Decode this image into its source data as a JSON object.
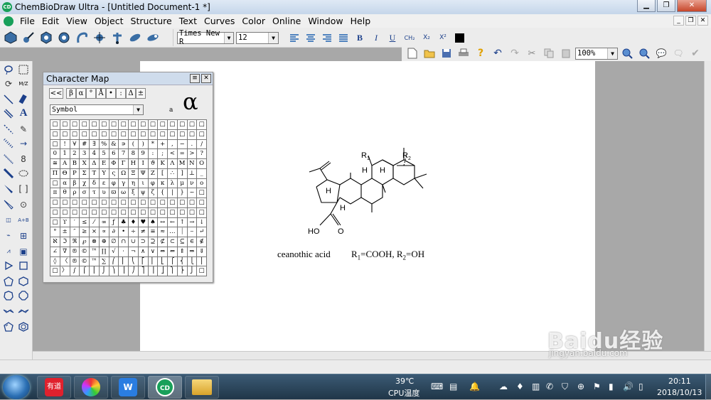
{
  "window": {
    "title": "ChemBioDraw Ultra - [Untitled Document-1 *]",
    "app_icon_text": "CD",
    "controls": [
      "minimize-icon",
      "restore-icon",
      "close-icon"
    ]
  },
  "menubar": {
    "items": [
      "File",
      "Edit",
      "View",
      "Object",
      "Structure",
      "Text",
      "Curves",
      "Color",
      "Online",
      "Window",
      "Help"
    ]
  },
  "text_toolbar": {
    "font_family_value": "Times New R",
    "font_size_value": "12",
    "bold": "B",
    "italic": "I",
    "underline": "U",
    "chem": "CH₂",
    "subscript": "X₂",
    "superscript": "X²"
  },
  "main_toolbar": {
    "zoom_value": "100%"
  },
  "character_map": {
    "title": "Character Map",
    "back_label": "<<",
    "recent": [
      "β",
      "α",
      "°",
      "Å",
      "•",
      ":",
      "Δ",
      "±"
    ],
    "font_value": "Symbol",
    "preview_small": "a",
    "preview_big": "α",
    "rows": [
      [
        "",
        "",
        "",
        "",
        "",
        "",
        "",
        "",
        "",
        "",
        "",
        "",
        "",
        "",
        "",
        ""
      ],
      [
        "",
        "",
        "",
        "",
        "",
        "",
        "",
        "",
        "",
        "",
        "",
        "",
        "",
        "",
        "",
        ""
      ],
      [
        "",
        "!",
        "∀",
        "#",
        "∃",
        "%",
        "&",
        "∍",
        "(",
        ")",
        "*",
        "+",
        ",",
        "−",
        ".",
        "/"
      ],
      [
        "0",
        "1",
        "2",
        "3",
        "4",
        "5",
        "6",
        "7",
        "8",
        "9",
        ":",
        ";",
        "<",
        "=",
        ">",
        "?"
      ],
      [
        "≅",
        "Α",
        "Β",
        "Χ",
        "Δ",
        "Ε",
        "Φ",
        "Γ",
        "Η",
        "Ι",
        "ϑ",
        "Κ",
        "Λ",
        "Μ",
        "Ν",
        "Ο"
      ],
      [
        "Π",
        "Θ",
        "Ρ",
        "Σ",
        "Τ",
        "Υ",
        "ς",
        "Ω",
        "Ξ",
        "Ψ",
        "Ζ",
        "[",
        "∴",
        "]",
        "⊥",
        "_"
      ],
      [
        "",
        "α",
        "β",
        "χ",
        "δ",
        "ε",
        "φ",
        "γ",
        "η",
        "ι",
        "φ",
        "κ",
        "λ",
        "μ",
        "ν",
        "ο"
      ],
      [
        "π",
        "θ",
        "ρ",
        "σ",
        "τ",
        "υ",
        "ϖ",
        "ω",
        "ξ",
        "ψ",
        "ζ",
        "{",
        "|",
        "}",
        "~",
        ""
      ],
      [
        "",
        "",
        "",
        "",
        "",
        "",
        "",
        "",
        "",
        "",
        "",
        "",
        "",
        "",
        "",
        ""
      ],
      [
        "",
        "",
        "",
        "",
        "",
        "",
        "",
        "",
        "",
        "",
        "",
        "",
        "",
        "",
        "",
        ""
      ],
      [
        "",
        "ϒ",
        "′",
        "≤",
        "⁄",
        "∞",
        "ƒ",
        "♣",
        "♦",
        "♥",
        "♠",
        "↔",
        "←",
        "↑",
        "→",
        "↓"
      ],
      [
        "°",
        "±",
        "″",
        "≥",
        "×",
        "∝",
        "∂",
        "•",
        "÷",
        "≠",
        "≡",
        "≈",
        "…",
        "⏐",
        "⎯",
        "↵"
      ],
      [
        "ℵ",
        "ℑ",
        "ℜ",
        "℘",
        "⊗",
        "⊕",
        "∅",
        "∩",
        "∪",
        "⊃",
        "⊇",
        "⊄",
        "⊂",
        "⊆",
        "∈",
        "∉"
      ],
      [
        "∠",
        "∇",
        "®",
        "©",
        "™",
        "∏",
        "√",
        "⋅",
        "¬",
        "∧",
        "∨",
        "⇔",
        "⇐",
        "⇑",
        "⇒",
        "⇓"
      ],
      [
        "◊",
        "〈",
        "®",
        "©",
        "™",
        "∑",
        "⎛",
        "⎜",
        "⎝",
        "⎡",
        "⎢",
        "⎣",
        "⎧",
        "⎨",
        "⎩",
        "⎪"
      ],
      [
        "",
        "〉",
        "∫",
        "⌠",
        "⎮",
        "⌡",
        "⎞",
        "⎟",
        "⎠",
        "⎤",
        "⎥",
        "⎦",
        "⎫",
        "⎬",
        "⎭",
        ""
      ]
    ]
  },
  "document": {
    "caption_name": "ceanothic acid",
    "formula_prefix_1": "R",
    "formula_sub_1": "1",
    "formula_mid": "=COOH, R",
    "formula_sub_2": "2",
    "formula_suffix": "=OH",
    "molecule": {
      "label_r1": "R",
      "label_r1_sub": "1",
      "label_r2": "R",
      "label_r2_sub": "2",
      "label_h": "H",
      "label_ho": "HO",
      "label_o": "O"
    }
  },
  "taskbar": {
    "apps": [
      "start-orb",
      "youdao-app",
      "color-app",
      "wps-app",
      "chemdraw-app",
      "explorer-app"
    ],
    "youdao_label": "有道",
    "temperature": "39℃",
    "cpu_label": "CPU温度",
    "time": "20:11",
    "date": "2018/10/13"
  },
  "watermark": {
    "text": "Baidu经验",
    "sub": "jingyan.baidu.com"
  },
  "colors": {
    "titlebar": "#c5d6ea",
    "workspace": "#a8a8a8",
    "taskbar": "#203648",
    "chemdraw_green": "#19a05a"
  }
}
